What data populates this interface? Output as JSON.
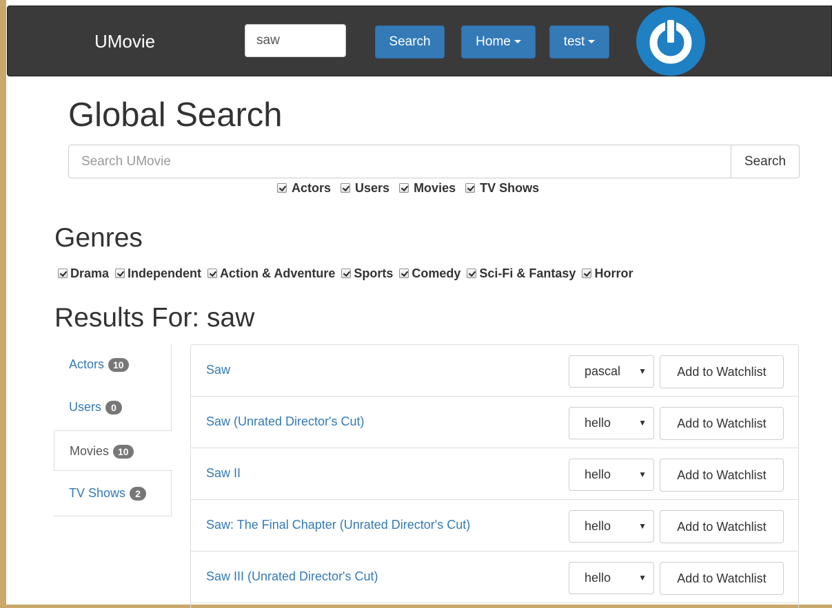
{
  "navbar": {
    "brand": "UMovie",
    "search_value": "saw",
    "search_button": "Search",
    "home_menu": "Home",
    "user_menu": "test",
    "logo_icon": "power-icon",
    "logo_color": "#1f80c4"
  },
  "global_search": {
    "title": "Global Search",
    "placeholder": "Search UMovie",
    "button": "Search",
    "scopes": [
      "Actors",
      "Users",
      "Movies",
      "TV Shows"
    ]
  },
  "genres": {
    "title": "Genres",
    "items": [
      "Drama",
      "Independent",
      "Action & Adventure",
      "Sports",
      "Comedy",
      "Sci-Fi & Fantasy",
      "Horror"
    ]
  },
  "results": {
    "title": "Results For: saw",
    "tabs": [
      {
        "label": "Actors",
        "count": "10"
      },
      {
        "label": "Users",
        "count": "0"
      },
      {
        "label": "Movies",
        "count": "10",
        "active": true
      },
      {
        "label": "TV Shows",
        "count": "2"
      }
    ],
    "rows": [
      {
        "title": "Saw",
        "watchlist": "pascal",
        "button": "Add to Watchlist"
      },
      {
        "title": "Saw (Unrated Director's Cut)",
        "watchlist": "hello",
        "button": "Add to Watchlist"
      },
      {
        "title": "Saw II",
        "watchlist": "hello",
        "button": "Add to Watchlist"
      },
      {
        "title": "Saw: The Final Chapter (Unrated Director's Cut)",
        "watchlist": "hello",
        "button": "Add to Watchlist"
      },
      {
        "title": "Saw III (Unrated Director's Cut)",
        "watchlist": "hello",
        "button": "Add to Watchlist"
      }
    ]
  },
  "colors": {
    "navbar_bg": "#3a3a3a",
    "primary": "#337ab7",
    "link": "#337ab7",
    "badge": "#777777"
  }
}
